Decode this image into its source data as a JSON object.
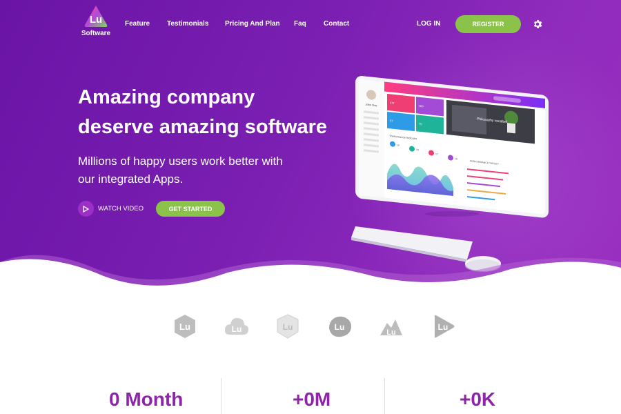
{
  "brand": {
    "logo_text": "Lu",
    "label": "Software"
  },
  "nav": {
    "items": [
      "Feature",
      "Testimonials",
      "Pricing And Plan",
      "Faq",
      "Contact"
    ]
  },
  "header": {
    "login_label": "LOG IN",
    "register_label": "REGISTER",
    "settings_icon": "gear-icon"
  },
  "hero": {
    "headline_line1": "Amazing company",
    "headline_line2": "deserve amazing software",
    "subline_line1": "Millions of happy users work better with",
    "subline_line2": "our integrated Apps.",
    "watch_label": "WATCH VIDEO",
    "get_started_label": "GET STARTED"
  },
  "mockup": {
    "profile_name": "John Doe",
    "tiles": [
      "377",
      "300",
      "57",
      "70"
    ],
    "section_title": "Performance Indicator",
    "indicators": [
      "15",
      "70",
      "17",
      "18"
    ],
    "banner_text": "Philosophy vocalbel",
    "side_title": "PERFORMANCE TARGET"
  },
  "stats": {
    "items": [
      "0 Month",
      "+0M",
      "+0K"
    ]
  },
  "colors": {
    "brand_purple": "#7a1fb2",
    "accent_green": "#8bc34a",
    "stat_purple": "#8e24aa"
  }
}
